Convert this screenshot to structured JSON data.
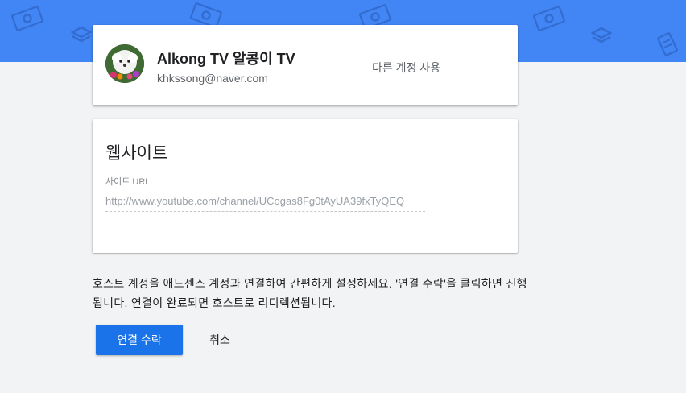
{
  "colors": {
    "banner": "#4285f4",
    "primary_button": "#1a73e8",
    "background": "#f1f3f4"
  },
  "banner": {
    "icons": [
      "money-icon",
      "stack-icon",
      "money-icon",
      "money-icon",
      "stack-icon",
      "money-icon",
      "stack-icon",
      "card-icon"
    ]
  },
  "account": {
    "avatar_icon": "dog-avatar",
    "name": "Alkong TV 알콩이 TV",
    "email": "khkssong@naver.com",
    "switch_label": "다른 계정 사용"
  },
  "site": {
    "title": "웹사이트",
    "url_label": "사이트 URL",
    "url_value": "http://www.youtube.com/channel/UCogas8Fg0tAyUA39fxTyQEQ"
  },
  "description": "호스트 계정을 애드센스 계정과 연결하여 간편하게 설정하세요. '연결 수락'을 클릭하면 진행됩니다. 연결이 완료되면 호스트로 리디렉션됩니다.",
  "actions": {
    "accept_label": "연결 수락",
    "cancel_label": "취소"
  }
}
